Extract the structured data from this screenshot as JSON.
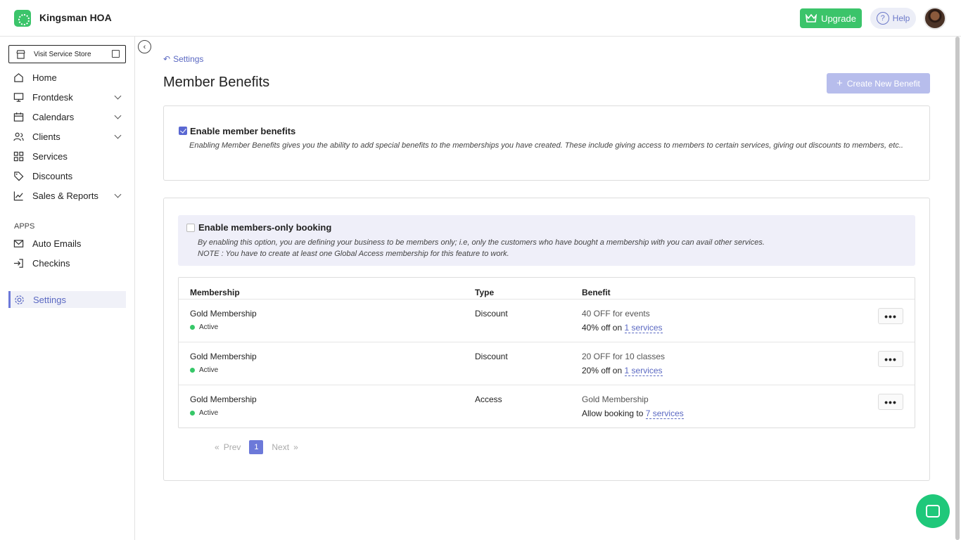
{
  "app": {
    "org_name": "Kingsman HOA"
  },
  "header": {
    "upgrade_label": "Upgrade",
    "help_label": "Help"
  },
  "sidebar": {
    "store_label": "Visit Service Store",
    "items": [
      {
        "label": "Home",
        "icon": "home-icon"
      },
      {
        "label": "Frontdesk",
        "icon": "monitor-icon"
      },
      {
        "label": "Calendars",
        "icon": "calendar-icon"
      },
      {
        "label": "Clients",
        "icon": "users-icon"
      },
      {
        "label": "Services",
        "icon": "grid-icon"
      },
      {
        "label": "Discounts",
        "icon": "tag-icon"
      },
      {
        "label": "Sales & Reports",
        "icon": "chart-icon"
      }
    ],
    "apps_label": "APPS",
    "apps": [
      {
        "label": "Auto Emails",
        "icon": "mail-icon"
      },
      {
        "label": "Checkins",
        "icon": "login-icon"
      }
    ],
    "settings_label": "Settings"
  },
  "page": {
    "breadcrumb": "Settings",
    "title": "Member Benefits",
    "create_label": "Create New Benefit"
  },
  "enable_benefits": {
    "label": "Enable member benefits",
    "checked": true,
    "description": "Enabling Member Benefits gives you the ability to add special benefits to the memberships you have created. These include giving access to members to certain services, giving out discounts to members, etc.."
  },
  "members_only": {
    "label": "Enable members-only booking",
    "checked": false,
    "description1": "By enabling this option, you are defining your business to be members only; i.e, only the customers who have bought a membership with you can avail other services.",
    "description2": "NOTE : You have to create at least one Global Access membership for this feature to work."
  },
  "table": {
    "headers": {
      "membership": "Membership",
      "type": "Type",
      "benefit": "Benefit"
    },
    "rows": [
      {
        "name": "Gold Membership",
        "status": "Active",
        "type": "Discount",
        "benefit_title": "40 OFF for events",
        "benefit_prefix": "40% off on",
        "services_link": "1 services",
        "more": "•••"
      },
      {
        "name": "Gold Membership",
        "status": "Active",
        "type": "Discount",
        "benefit_title": "20 OFF for 10 classes",
        "benefit_prefix": "20% off on",
        "services_link": "1 services",
        "more": "•••"
      },
      {
        "name": "Gold Membership",
        "status": "Active",
        "type": "Access",
        "benefit_title": "Gold Membership",
        "benefit_prefix": "Allow booking to",
        "services_link": "7 services",
        "more": "•••"
      }
    ]
  },
  "pagination": {
    "first": "«",
    "prev": "Prev",
    "current": "1",
    "next": "Next",
    "last": "»"
  }
}
